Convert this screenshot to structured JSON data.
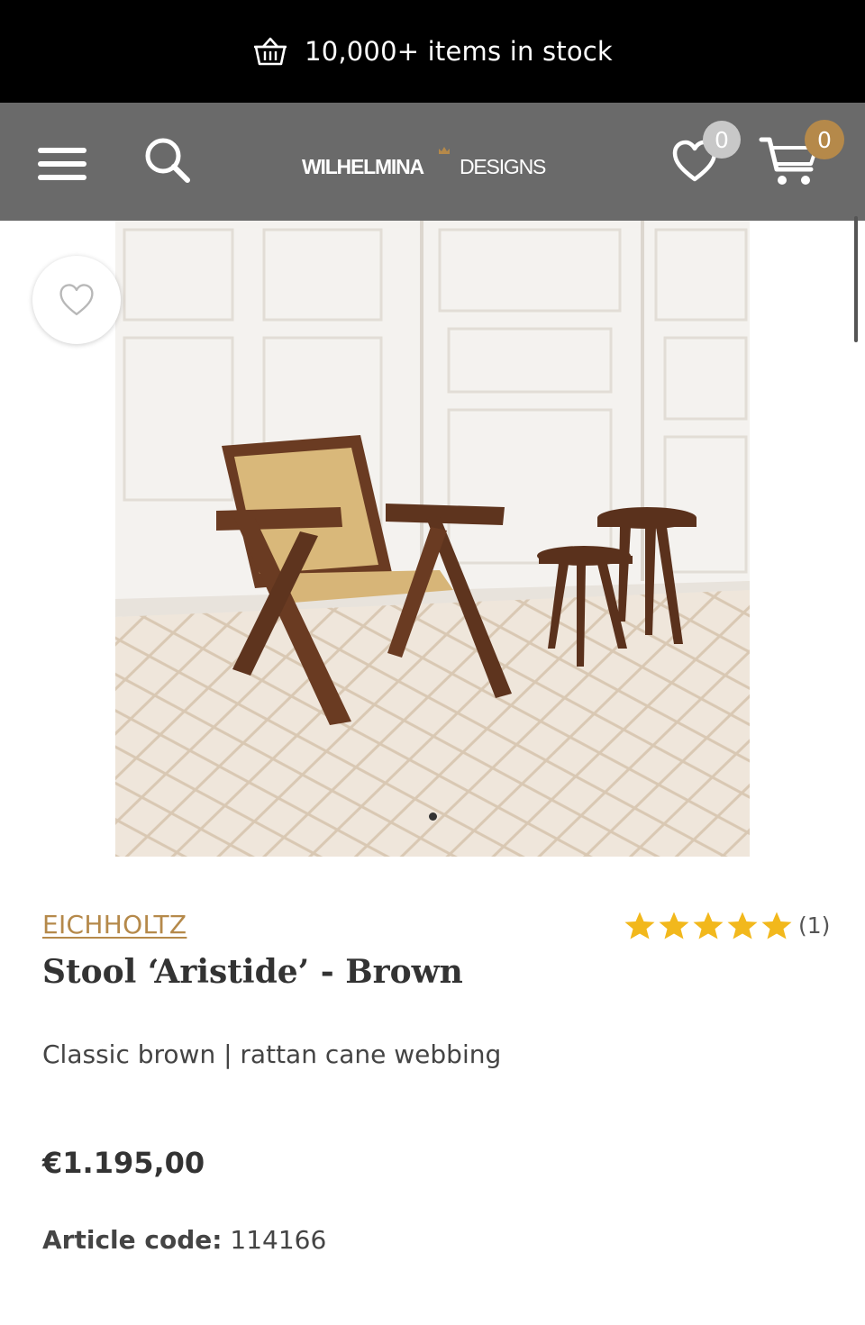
{
  "promo": {
    "text": "10,000+ items in stock",
    "icon": "basket-icon"
  },
  "header": {
    "logo_part1": "WILHELMINA",
    "logo_part2": "DESIGNS",
    "wishlist_count": "0",
    "cart_count": "0",
    "colors": {
      "header_bg": "#6a6a6a",
      "accent": "#b5894a"
    }
  },
  "product": {
    "brand": "EICHHOLTZ",
    "title": "Stool ‘Aristide’ - Brown",
    "subtitle": "Classic brown | rattan cane webbing",
    "price": "€1.195,00",
    "article_label": "Article code:",
    "article_code": "114166",
    "rating_stars": 5,
    "rating_count": "(1)",
    "image_count": 1,
    "image_active": 1
  }
}
